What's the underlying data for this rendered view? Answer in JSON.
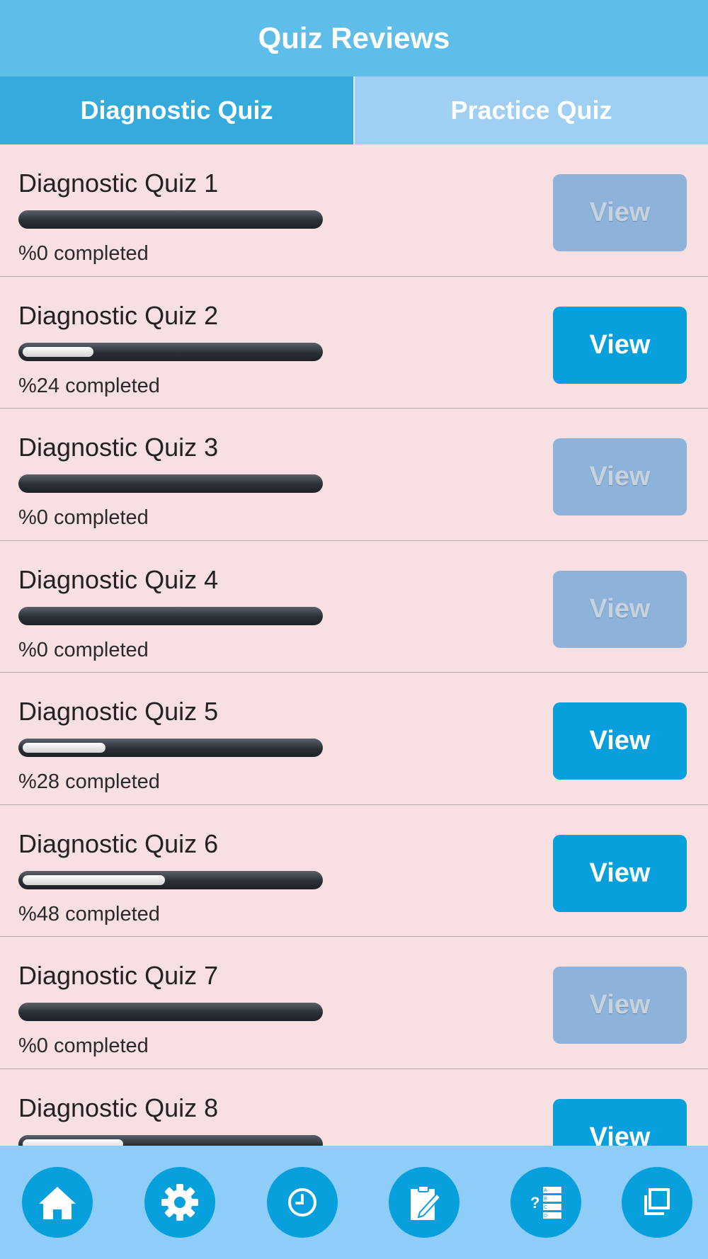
{
  "header": {
    "title": "Quiz Reviews"
  },
  "tabs": [
    {
      "label": "Diagnostic Quiz",
      "active": true
    },
    {
      "label": "Practice Quiz",
      "active": false
    }
  ],
  "quizzes": [
    {
      "title": "Diagnostic Quiz 1",
      "progress": 0,
      "status": "%0 completed",
      "button": "View",
      "enabled": false
    },
    {
      "title": "Diagnostic Quiz 2",
      "progress": 24,
      "status": "%24 completed",
      "button": "View",
      "enabled": true
    },
    {
      "title": "Diagnostic Quiz 3",
      "progress": 0,
      "status": "%0 completed",
      "button": "View",
      "enabled": false
    },
    {
      "title": "Diagnostic Quiz 4",
      "progress": 0,
      "status": "%0 completed",
      "button": "View",
      "enabled": false
    },
    {
      "title": "Diagnostic Quiz 5",
      "progress": 28,
      "status": "%28 completed",
      "button": "View",
      "enabled": true
    },
    {
      "title": "Diagnostic Quiz 6",
      "progress": 48,
      "status": "%48 completed",
      "button": "View",
      "enabled": true
    },
    {
      "title": "Diagnostic Quiz 7",
      "progress": 0,
      "status": "%0 completed",
      "button": "View",
      "enabled": false
    },
    {
      "title": "Diagnostic Quiz 8",
      "progress": 34,
      "status": "",
      "button": "View",
      "enabled": true
    }
  ],
  "bottom_nav": [
    {
      "icon": "home-icon"
    },
    {
      "icon": "gear-icon"
    },
    {
      "icon": "clock-icon"
    },
    {
      "icon": "clipboard-edit-icon"
    },
    {
      "icon": "quiz-list-icon"
    },
    {
      "icon": "copy-icon"
    }
  ],
  "colors": {
    "header": "#5ebde9",
    "tab_active": "#35abdd",
    "tab_inactive": "#a0cff4",
    "list_background": "#f8dfe2",
    "button_enabled": "#079fdc",
    "button_disabled": "#8db3db",
    "bottom_bar": "#8dcdf7"
  }
}
